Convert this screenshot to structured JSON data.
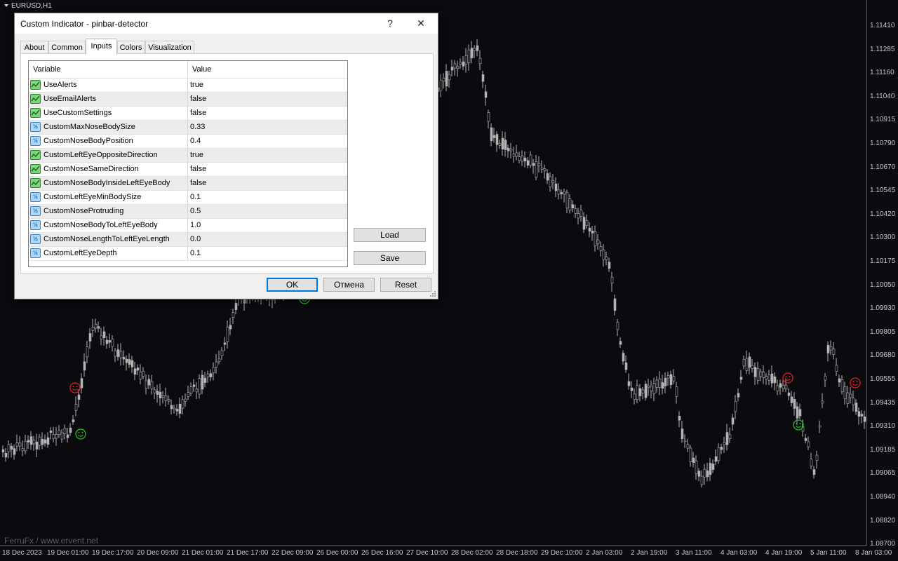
{
  "chart": {
    "symbol": "EURUSD,H1",
    "watermark": "FerruFx / www.ervent.net",
    "price_labels": [
      "1.11410",
      "1.11285",
      "1.11160",
      "1.11040",
      "1.10915",
      "1.10790",
      "1.10670",
      "1.10545",
      "1.10420",
      "1.10300",
      "1.10175",
      "1.10050",
      "1.09930",
      "1.09805",
      "1.09680",
      "1.09555",
      "1.09435",
      "1.09310",
      "1.09185",
      "1.09065",
      "1.08940",
      "1.08820",
      "1.08700"
    ],
    "time_labels": [
      "18 Dec 2023",
      "19 Dec 01:00",
      "19 Dec 17:00",
      "20 Dec 09:00",
      "21 Dec 01:00",
      "21 Dec 17:00",
      "22 Dec 09:00",
      "26 Dec 00:00",
      "26 Dec 16:00",
      "27 Dec 10:00",
      "28 Dec 02:00",
      "28 Dec 18:00",
      "29 Dec 10:00",
      "2 Jan 03:00",
      "2 Jan 19:00",
      "3 Jan 11:00",
      "4 Jan 03:00",
      "4 Jan 19:00",
      "5 Jan 11:00",
      "8 Jan 03:00"
    ],
    "colors": {
      "background": "#0a0a0f",
      "candle": "#b4b4b4",
      "bearish_signal": "#e02020",
      "bullish_signal": "#22c022"
    }
  },
  "dialog": {
    "title": "Custom Indicator - pinbar-detector",
    "help_glyph": "?",
    "close_glyph": "✕",
    "tabs": [
      {
        "label": "About",
        "active": false
      },
      {
        "label": "Common",
        "active": false
      },
      {
        "label": "Inputs",
        "active": true
      },
      {
        "label": "Colors",
        "active": false
      },
      {
        "label": "Visualization",
        "active": false
      }
    ],
    "grid": {
      "col_variable": "Variable",
      "col_value": "Value",
      "rows": [
        {
          "icon": "bool-icon",
          "variable": "UseAlerts",
          "value": "true"
        },
        {
          "icon": "bool-icon",
          "variable": "UseEmailAlerts",
          "value": "false"
        },
        {
          "icon": "bool-icon",
          "variable": "UseCustomSettings",
          "value": "false"
        },
        {
          "icon": "number-icon",
          "variable": "CustomMaxNoseBodySize",
          "value": "0.33"
        },
        {
          "icon": "number-icon",
          "variable": "CustomNoseBodyPosition",
          "value": "0.4"
        },
        {
          "icon": "bool-icon",
          "variable": "CustomLeftEyeOppositeDirection",
          "value": "true"
        },
        {
          "icon": "bool-icon",
          "variable": "CustomNoseSameDirection",
          "value": "false"
        },
        {
          "icon": "bool-icon",
          "variable": "CustomNoseBodyInsideLeftEyeBody",
          "value": "false"
        },
        {
          "icon": "number-icon",
          "variable": "CustomLeftEyeMinBodySize",
          "value": "0.1"
        },
        {
          "icon": "number-icon",
          "variable": "CustomNoseProtruding",
          "value": "0.5"
        },
        {
          "icon": "number-icon",
          "variable": "CustomNoseBodyToLeftEyeBody",
          "value": "1.0"
        },
        {
          "icon": "number-icon",
          "variable": "CustomNoseLengthToLeftEyeLength",
          "value": "0.0"
        },
        {
          "icon": "number-icon",
          "variable": "CustomLeftEyeDepth",
          "value": "0.1"
        }
      ],
      "number_icon_glyph": "½"
    },
    "buttons": {
      "load": "Load",
      "save": "Save",
      "ok": "OK",
      "cancel": "Отмена",
      "reset": "Reset"
    }
  }
}
